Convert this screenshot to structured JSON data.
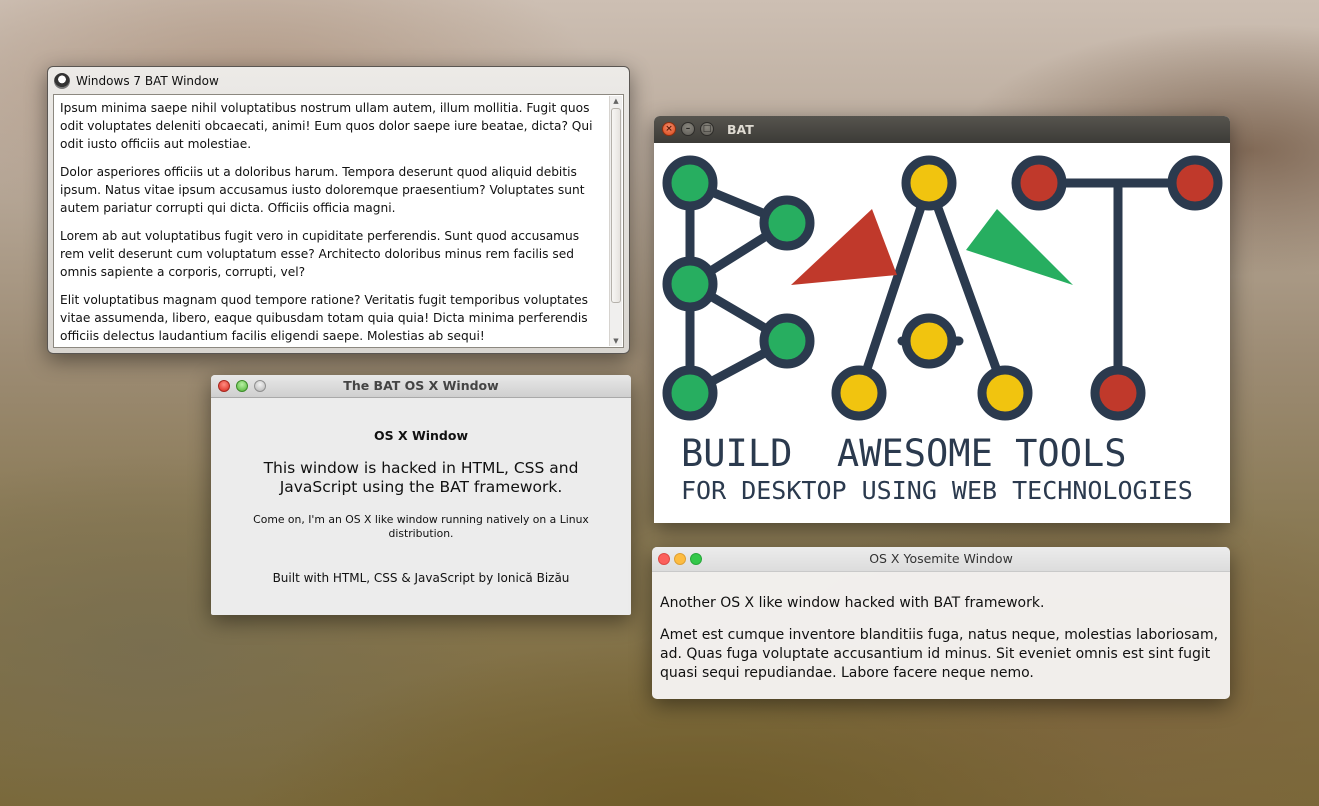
{
  "win7": {
    "title": "Windows 7 BAT Window",
    "paragraphs": [
      "Ipsum minima saepe nihil voluptatibus nostrum ullam autem, illum mollitia. Fugit quos odit voluptates deleniti obcaecati, animi! Eum quos dolor saepe iure beatae, dicta? Qui odit iusto officiis aut molestiae.",
      "Dolor asperiores officiis ut a doloribus harum. Tempora deserunt quod aliquid debitis ipsum. Natus vitae ipsum accusamus iusto doloremque praesentium? Voluptates sunt autem pariatur corrupti qui dicta. Officiis officia magni.",
      "Lorem ab aut voluptatibus fugit vero in cupiditate perferendis. Sunt quod accusamus rem velit deserunt cum voluptatum esse? Architecto doloribus minus rem facilis sed omnis sapiente a corporis, corrupti, vel?",
      "Elit voluptatibus magnam quod tempore ratione? Veritatis fugit temporibus voluptates vitae assumenda, libero, eaque quibusdam totam quia quia! Dicta minima perferendis officiis delectus laudantium facilis eligendi saepe. Molestias ab sequi!"
    ]
  },
  "osx": {
    "title": "The BAT OS X Window",
    "heading": "OS X Window",
    "big_text": "This window is hacked in HTML, CSS and JavaScript using the BAT framework.",
    "small_text": "Come on, I'm an OS X like window running natively on a Linux distribution.",
    "footer": "Built with HTML, CSS & JavaScript by Ionică Bizău"
  },
  "bat": {
    "title": "BAT",
    "logo_line1": "BUILD  AWESOME TOOLS",
    "logo_line2": "FOR DESKTOP USING WEB TECHNOLOGIES",
    "colors": {
      "navy": "#2b3a4e",
      "green": "#27ae60",
      "yellow": "#f1c40f",
      "red": "#c0392b"
    }
  },
  "yosemite": {
    "title": "OS X Yosemite Window",
    "line1": "Another OS X like window hacked with BAT framework.",
    "line2": "Amet est cumque inventore blanditiis fuga, natus neque, molestias laboriosam, ad. Quas fuga voluptate accusantium id minus. Sit eveniet omnis est sint fugit quasi sequi repudiandae. Labore facere neque nemo."
  }
}
